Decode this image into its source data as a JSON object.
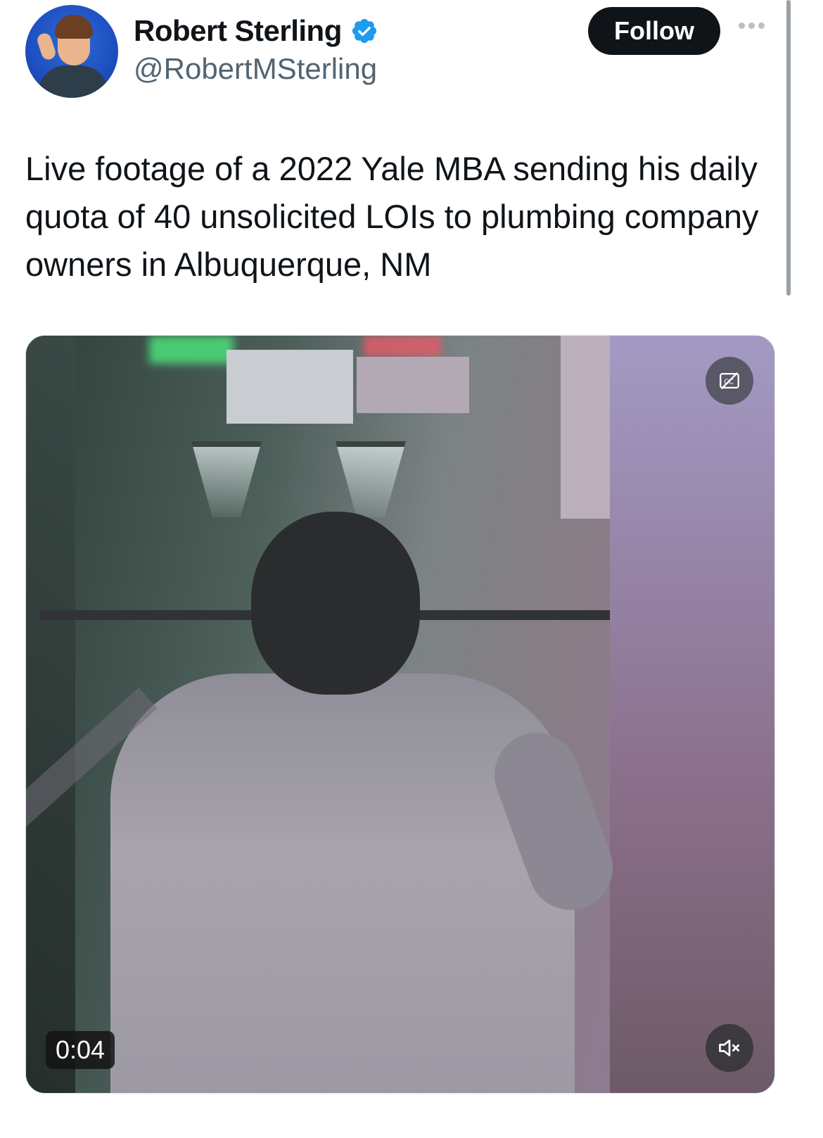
{
  "author": {
    "name": "Robert Sterling",
    "handle": "@RobertMSterling",
    "verified": true
  },
  "actions": {
    "follow_label": "Follow",
    "more_icon": "more-horizontal-icon"
  },
  "tweet": {
    "text": "Live footage of a 2022 Yale MBA sending his daily quota of 40 unsolicited LOIs to plumbing company owners in Albuquerque, NM"
  },
  "video": {
    "timestamp": "0:04",
    "captions_icon": "captions-off-icon",
    "mute_icon": "muted-speaker-icon"
  },
  "colors": {
    "follow_bg": "#0f1419",
    "verified_badge": "#1d9bf0",
    "secondary_text": "#536471"
  }
}
